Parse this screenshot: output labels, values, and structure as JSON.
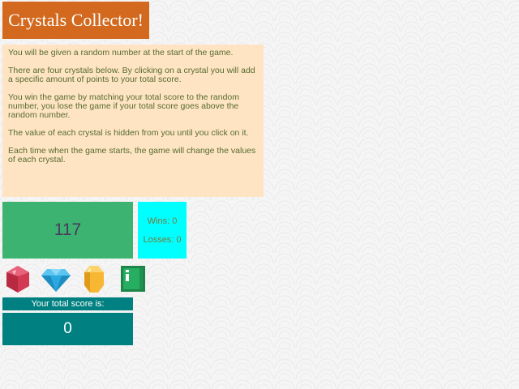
{
  "title": "Crystals Collector!",
  "instructions": [
    "You will be given a random number at the start of the game.",
    "There are four crystals below. By clicking on a crystal you will add a specific amount of points to your total score.",
    "You win the game by matching your total score to the random number, you lose the game if your total score goes above the random number.",
    "The value of each crystal is hidden from you until you click on it.",
    "Each time when the game starts, the game will change the values of each crystal."
  ],
  "target_number": "117",
  "stats": {
    "wins": "Wins: 0",
    "losses": "Losses: 0"
  },
  "crystals": [
    {
      "name": "red-crystal-icon",
      "color": "#d23a52"
    },
    {
      "name": "blue-diamond-icon",
      "color": "#29a9e0"
    },
    {
      "name": "yellow-crystal-icon",
      "color": "#f7b733"
    },
    {
      "name": "green-crystal-icon",
      "color": "#27ae60"
    }
  ],
  "score": {
    "label": "Your total score is:",
    "value": "0"
  }
}
